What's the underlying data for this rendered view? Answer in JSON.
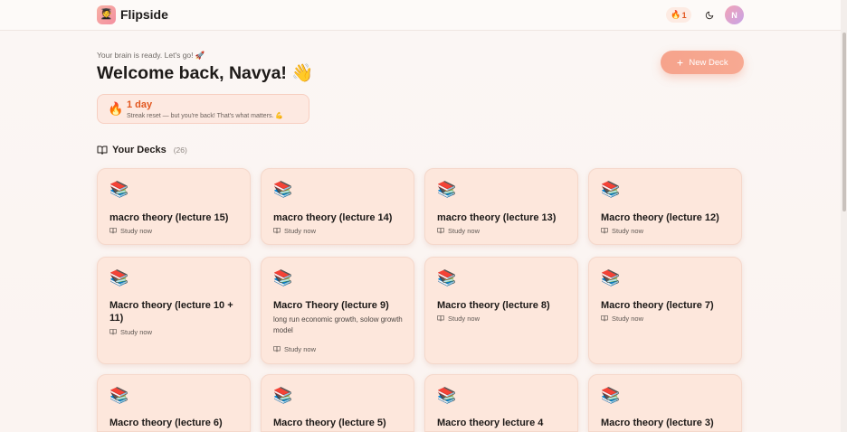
{
  "app": {
    "logo_glyph": "🧑‍🎓",
    "brand": "Flipside",
    "streak_glyph": "🔥",
    "streak_count": "1",
    "avatar_initial": "N"
  },
  "welcome": {
    "tagline": "Your brain is ready. Let's go! 🚀",
    "heading": "Welcome back, Navya! 👋",
    "new_deck_label": "New Deck"
  },
  "streak": {
    "glyph": "🔥",
    "days": "1 day",
    "message": "Streak reset — but you're back! That's what matters. 💪"
  },
  "decks": {
    "heading": "Your Decks",
    "count": "(26)",
    "study_label": "Study now",
    "deck_emoji": "📚",
    "items": [
      {
        "title": "macro theory (lecture 15)",
        "desc": ""
      },
      {
        "title": "macro theory (lecture 14)",
        "desc": ""
      },
      {
        "title": "macro theory (lecture 13)",
        "desc": ""
      },
      {
        "title": "Macro theory (lecture 12)",
        "desc": ""
      },
      {
        "title": "Macro theory (lecture 10 + 11)",
        "desc": ""
      },
      {
        "title": "Macro Theory (lecture 9)",
        "desc": "long run economic growth, solow growth model"
      },
      {
        "title": "Macro theory (lecture 8)",
        "desc": ""
      },
      {
        "title": "Macro theory (lecture 7)",
        "desc": ""
      },
      {
        "title": "Macro theory (lecture 6)",
        "desc": ""
      },
      {
        "title": "Macro theory (lecture 5)",
        "desc": ""
      },
      {
        "title": "Macro theory lecture 4",
        "desc": ""
      },
      {
        "title": "Macro theory (lecture 3)",
        "desc": ""
      }
    ]
  },
  "colors": {
    "accent": "#f6a38c",
    "card_bg": "#fde7dc",
    "streak_orange": "#e2571f"
  },
  "icons": {
    "theme_toggle": "moon-icon",
    "new_deck": "plus-icon",
    "decks_heading": "book-open-icon",
    "study": "book-open-icon"
  }
}
